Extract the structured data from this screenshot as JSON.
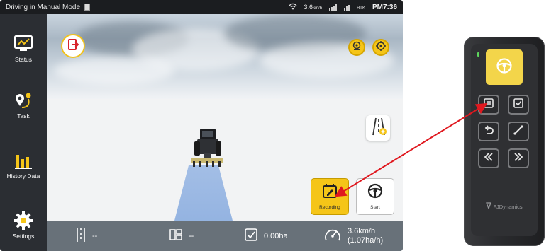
{
  "statusbar": {
    "title": "Driving in Manual Mode",
    "network_speed": "3.6",
    "network_unit": "km/h",
    "rtk_label": "RTK",
    "time": "PM7:36"
  },
  "sidebar": {
    "items": [
      {
        "label": "Status",
        "icon": "monitor-chart-icon"
      },
      {
        "label": "Task",
        "icon": "route-pin-icon"
      },
      {
        "label": "History Data",
        "icon": "bar-chart-icon"
      },
      {
        "label": "Settings",
        "icon": "gear-icon"
      }
    ]
  },
  "controls": {
    "recording_label": "Recording",
    "start_label": "Start"
  },
  "bottombar": {
    "line_value": "--",
    "area_mode_value": "--",
    "area_value": "0.00ha",
    "speed_value": "3.6km/h",
    "rate_value": "(1.07ha/h)"
  },
  "remote": {
    "brand": "FJDynamics"
  },
  "colors": {
    "accent": "#f5c518",
    "sidebar": "#2b2e33",
    "arrow": "#e0181f"
  }
}
